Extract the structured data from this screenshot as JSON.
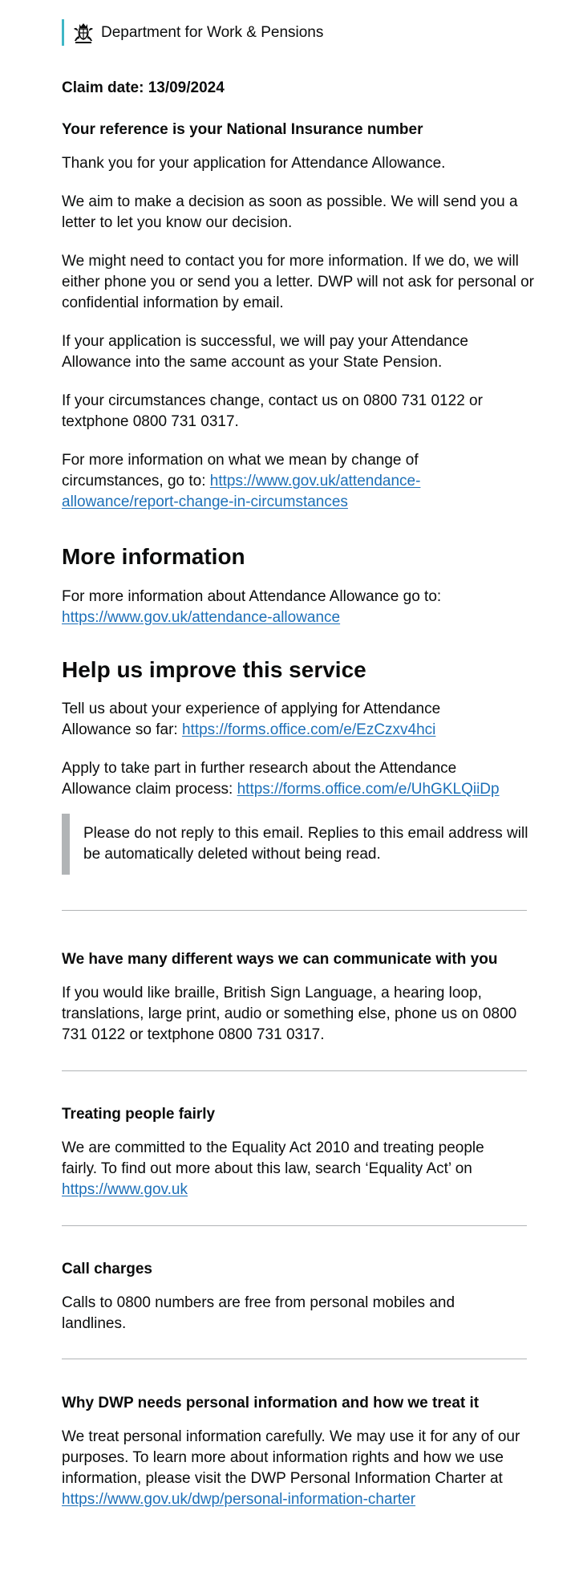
{
  "header": {
    "department": "Department for Work & Pensions",
    "logo_icon": "royal-crest-icon"
  },
  "colors": {
    "text": "#0b0c0c",
    "link": "#1d70b8",
    "header_bar": "#3fb6c6",
    "inset_bar": "#b1b4b6",
    "divider": "#b1b4b6"
  },
  "main": {
    "claim_date": "Claim date: 13/09/2024",
    "reference": "Your reference is your National Insurance number",
    "thanks": "Thank you for your application for Attendance Allowance.",
    "decision": "We aim to make a decision as soon as possible. We will send you a letter to let you know our decision.",
    "contact": "We might need to contact you for more information. If we do, we will either phone you or send you a letter. DWP will not ask for personal or confidential information by email.",
    "payment": "If your application is successful, we will pay your Attendance Allowance into the same account as your State Pension.",
    "change": "If your circumstances change, contact us on 0800 731 0122 or textphone 0800 731 0317.",
    "change_info_prefix": "For more information on what we mean by change of circumstances, go to: ",
    "change_info_link": "https://www.gov.uk/attendance-allowance/report-change-in-circumstances"
  },
  "more_info": {
    "heading": "More information",
    "text": "For more information about Attendance Allowance go to: ",
    "link": "https://www.gov.uk/attendance-allowance"
  },
  "improve": {
    "heading": "Help us improve this service",
    "experience_text": "Tell us about your experience of applying for Attendance Allowance so far: ",
    "experience_link": "https://forms.office.com/e/EzCzxv4hci",
    "research_text": "Apply to take part in further research about the Attendance Allowance claim process: ",
    "research_link": "https://forms.office.com/e/UhGKLQiiDp"
  },
  "notice": "Please do not reply to this email. Replies to this email address will be automatically deleted without being read.",
  "footer": {
    "communicate_heading": "We have many different ways we can communicate with you",
    "communicate_text": "If you would like braille, British Sign Language, a hearing loop, translations, large print, audio or something else, phone us on 0800 731 0122 or textphone 0800 731 0317.",
    "fair_heading": "Treating people fairly",
    "fair_text": "We are committed to the Equality Act 2010 and treating people fairly. To find out more about this law, search ‘Equality Act’ on ",
    "fair_link": "https://www.gov.uk",
    "charges_heading": "Call charges",
    "charges_text": "Calls to 0800 numbers are free from personal mobiles and landlines.",
    "privacy_heading": "Why DWP needs personal information and how we treat it",
    "privacy_text": "We treat personal information carefully. We may use it for any of our purposes. To learn more about information rights and how we use information, please visit the DWP Personal Information Charter at ",
    "privacy_link": "https://www.gov.uk/dwp/personal-information-charter"
  }
}
